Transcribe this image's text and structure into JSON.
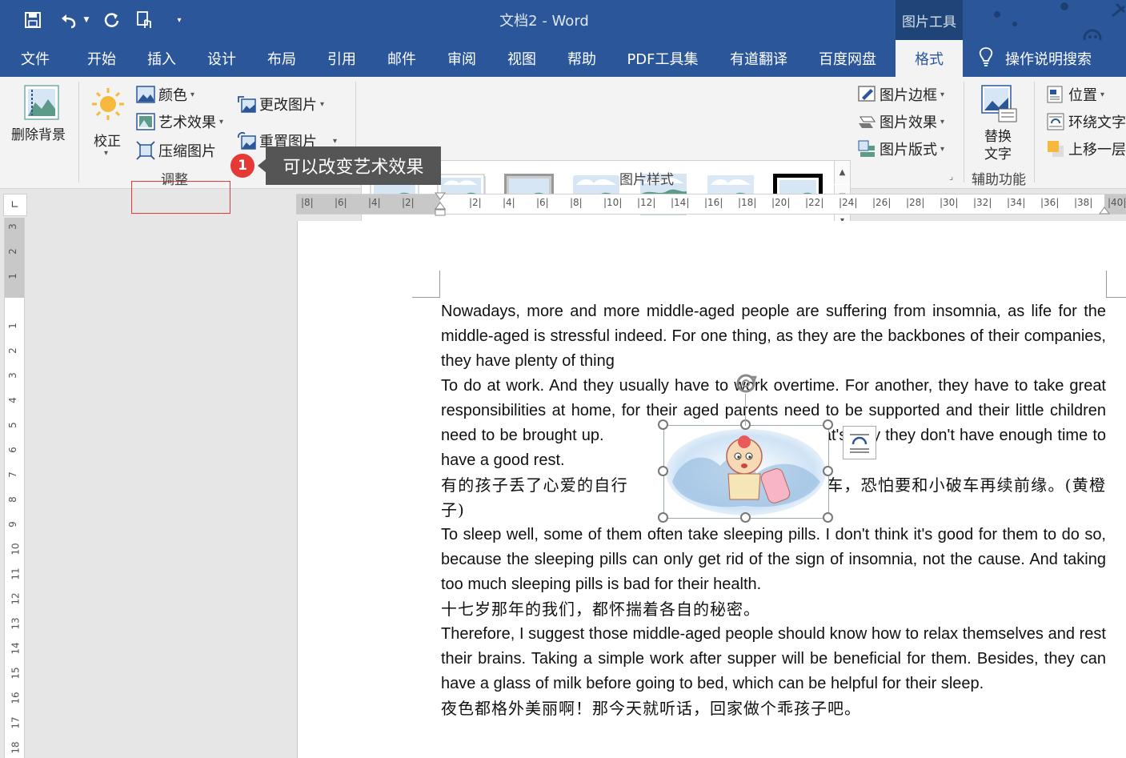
{
  "app": {
    "title": "文档2 - Word",
    "context_tools_label": "图片工具"
  },
  "tabs": [
    {
      "label": "文件",
      "active": false
    },
    {
      "label": "开始",
      "active": false
    },
    {
      "label": "插入",
      "active": false
    },
    {
      "label": "设计",
      "active": false
    },
    {
      "label": "布局",
      "active": false
    },
    {
      "label": "引用",
      "active": false
    },
    {
      "label": "邮件",
      "active": false
    },
    {
      "label": "审阅",
      "active": false
    },
    {
      "label": "视图",
      "active": false
    },
    {
      "label": "帮助",
      "active": false
    },
    {
      "label": "PDF工具集",
      "active": false
    },
    {
      "label": "有道翻译",
      "active": false
    },
    {
      "label": "百度网盘",
      "active": false
    },
    {
      "label": "格式",
      "active": true
    }
  ],
  "tell_me": "操作说明搜索",
  "ribbon": {
    "adjust": {
      "remove_bg": "删除背景",
      "corrections": "校正",
      "color": "颜色",
      "artistic_effects": "艺术效果",
      "compress": "压缩图片",
      "change_picture": "更改图片",
      "reset_picture": "重置图片",
      "group_label": "调整"
    },
    "styles": {
      "border": "图片边框",
      "effects": "图片效果",
      "layout": "图片版式",
      "group_label": "图片样式"
    },
    "accessibility": {
      "alt_text_line1": "替换",
      "alt_text_line2": "文字",
      "group_label": "辅助功能"
    },
    "arrange": {
      "position": "位置",
      "wrap_text": "环绕文字",
      "bring_forward": "上移一层"
    }
  },
  "tooltip": {
    "badge": "1",
    "text": "可以改变艺术效果"
  },
  "ruler": {
    "h_labels": [
      "8",
      "6",
      "4",
      "2",
      "",
      "2",
      "4",
      "6",
      "8",
      "10",
      "12",
      "14",
      "16",
      "18",
      "20",
      "22",
      "24",
      "26",
      "28",
      "30",
      "32",
      "34",
      "36",
      "38",
      "40"
    ],
    "v_labels": [
      "3",
      "2",
      "1",
      "",
      "1",
      "2",
      "3",
      "4",
      "5",
      "6",
      "7",
      "8",
      "9",
      "10",
      "11",
      "12",
      "13",
      "14",
      "15",
      "16",
      "17",
      "18"
    ]
  },
  "document": {
    "p1": "Nowadays, more and more middle-aged people are suffering from insomnia, as life for the middle-aged is stressful indeed. For one thing, as they are the backbones of their companies, they have plenty of thing",
    "p2a": "To do at work. And they usually have to work overtime. For another, they have to take great responsibilities at home, for their aged parents need to be supported and their little children need to be brought up.",
    "p2b": "That's why they don't have enough time to have a good rest.",
    "p3a": "有的孩子丢了心爱的自行",
    "p3b": "车，恐怕要和小破车再续前缘。(黄橙子)",
    "p4": "To sleep well, some of them often take sleeping pills. I don't think it's good for them to do so, because the sleeping pills can only get rid of the sign of insomnia, not the cause. And taking too much sleeping pills is bad for their health.",
    "p5": "十七岁那年的我们，都怀揣着各自的秘密。",
    "p6": "Therefore, I suggest those middle-aged people should know how to relax themselves and rest their brains. Taking a simple work after supper will be beneficial for them. Besides, they can have a glass of milk before going to bed, which can be helpful for their sleep.",
    "p7": "夜色都格外美丽啊！那今天就听话，回家做个乖孩子吧。"
  },
  "colors": {
    "title_bar": "#2b579a",
    "context_tab": "#1e4478",
    "ribbon": "#f3f3f3",
    "tooltip_bg": "#555555",
    "highlight": "#e53935"
  }
}
